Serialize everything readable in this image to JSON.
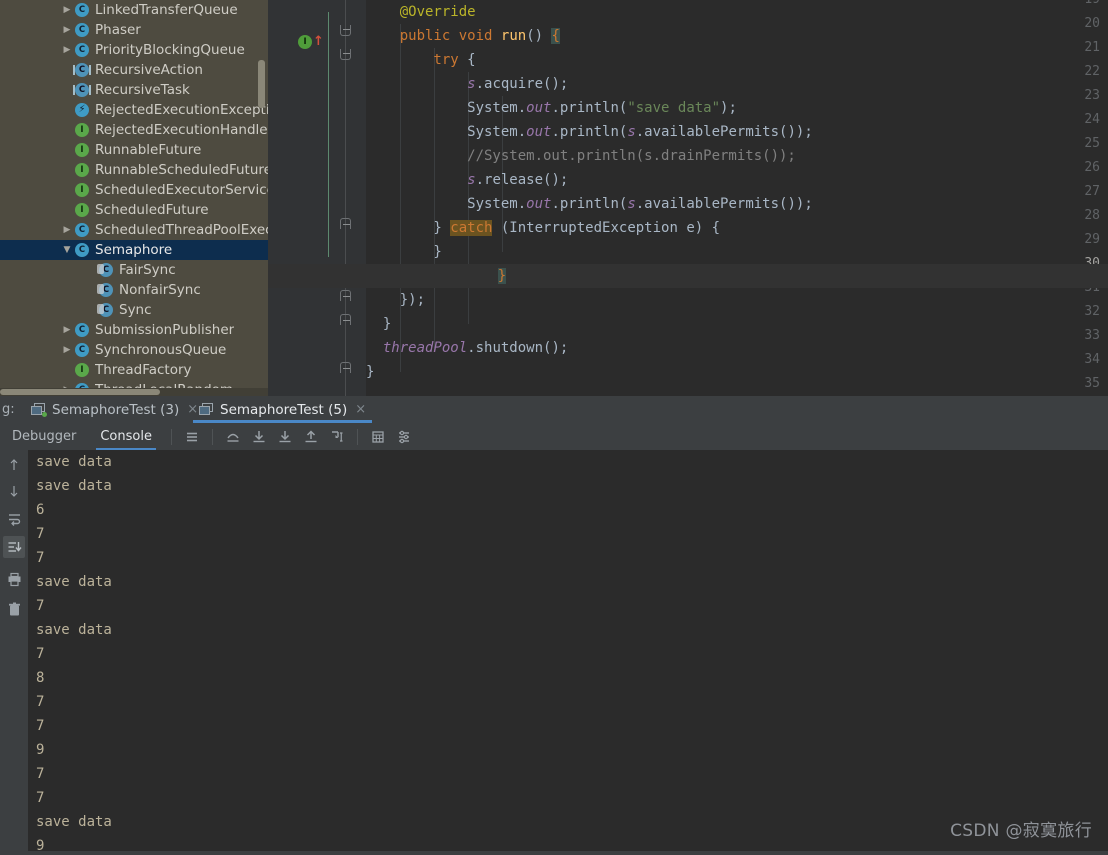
{
  "tree": {
    "name": "structure-tree",
    "items": [
      {
        "label": "LinkedTransferQueue",
        "indent": 0,
        "twisty": "collapsed",
        "icon": "class-icon",
        "glyph": "C",
        "kind": "cls",
        "selected": false
      },
      {
        "label": "Phaser",
        "indent": 0,
        "twisty": "collapsed",
        "icon": "class-icon",
        "glyph": "C",
        "kind": "cls",
        "selected": false
      },
      {
        "label": "PriorityBlockingQueue",
        "indent": 0,
        "twisty": "collapsed",
        "icon": "class-icon",
        "glyph": "C",
        "kind": "cls",
        "selected": false
      },
      {
        "label": "RecursiveAction",
        "indent": 0,
        "twisty": "none",
        "icon": "abstract-class-icon",
        "glyph": "C",
        "kind": "abs",
        "selected": false
      },
      {
        "label": "RecursiveTask",
        "indent": 0,
        "twisty": "none",
        "icon": "abstract-class-icon",
        "glyph": "C",
        "kind": "abs",
        "selected": false
      },
      {
        "label": "RejectedExecutionExceptio",
        "indent": 0,
        "twisty": "none",
        "icon": "exception-class-icon",
        "glyph": "⚡",
        "kind": "excp",
        "selected": false
      },
      {
        "label": "RejectedExecutionHandler",
        "indent": 0,
        "twisty": "none",
        "icon": "interface-icon",
        "glyph": "I",
        "kind": "iface",
        "selected": false
      },
      {
        "label": "RunnableFuture",
        "indent": 0,
        "twisty": "none",
        "icon": "interface-icon",
        "glyph": "I",
        "kind": "iface",
        "selected": false
      },
      {
        "label": "RunnableScheduledFuture",
        "indent": 0,
        "twisty": "none",
        "icon": "interface-icon",
        "glyph": "I",
        "kind": "iface",
        "selected": false
      },
      {
        "label": "ScheduledExecutorService",
        "indent": 0,
        "twisty": "none",
        "icon": "interface-icon",
        "glyph": "I",
        "kind": "iface",
        "selected": false
      },
      {
        "label": "ScheduledFuture",
        "indent": 0,
        "twisty": "none",
        "icon": "interface-icon",
        "glyph": "I",
        "kind": "iface",
        "selected": false
      },
      {
        "label": "ScheduledThreadPoolExecu",
        "indent": 0,
        "twisty": "collapsed",
        "icon": "class-icon",
        "glyph": "C",
        "kind": "cls",
        "selected": false
      },
      {
        "label": "Semaphore",
        "indent": 0,
        "twisty": "expanded",
        "icon": "class-icon",
        "glyph": "C",
        "kind": "cls",
        "selected": true
      },
      {
        "label": "FairSync",
        "indent": 1,
        "twisty": "none",
        "icon": "inner-class-icon",
        "glyph": "C",
        "kind": "inner",
        "selected": false
      },
      {
        "label": "NonfairSync",
        "indent": 1,
        "twisty": "none",
        "icon": "inner-class-icon",
        "glyph": "C",
        "kind": "inner",
        "selected": false
      },
      {
        "label": "Sync",
        "indent": 1,
        "twisty": "none",
        "icon": "inner-class-icon",
        "glyph": "C",
        "kind": "inner",
        "selected": false
      },
      {
        "label": "SubmissionPublisher",
        "indent": 0,
        "twisty": "collapsed",
        "icon": "class-icon",
        "glyph": "C",
        "kind": "cls",
        "selected": false
      },
      {
        "label": "SynchronousQueue",
        "indent": 0,
        "twisty": "collapsed",
        "icon": "class-icon",
        "glyph": "C",
        "kind": "cls",
        "selected": false
      },
      {
        "label": "ThreadFactory",
        "indent": 0,
        "twisty": "none",
        "icon": "interface-icon",
        "glyph": "I",
        "kind": "iface",
        "selected": false
      },
      {
        "label": "ThreadLocalRandom",
        "indent": 0,
        "twisty": "collapsed",
        "icon": "class-icon",
        "glyph": "C",
        "kind": "cls",
        "selected": false
      }
    ]
  },
  "editor": {
    "name": "code-editor",
    "current_line": 30,
    "run_marker_line": 20,
    "line_numbers": [
      19,
      20,
      21,
      22,
      23,
      24,
      25,
      26,
      27,
      28,
      29,
      30,
      31,
      32,
      33,
      34,
      35
    ],
    "lines": [
      {
        "num": 19,
        "text": "@Override"
      },
      {
        "num": 20,
        "text": "public void run() {"
      },
      {
        "num": 21,
        "text": "try {"
      },
      {
        "num": 22,
        "text": "s.acquire();"
      },
      {
        "num": 23,
        "text": "System.out.println(\"save data\");"
      },
      {
        "num": 24,
        "text": "System.out.println(s.availablePermits());"
      },
      {
        "num": 25,
        "text": "//System.out.println(s.drainPermits());"
      },
      {
        "num": 26,
        "text": "s.release();"
      },
      {
        "num": 27,
        "text": "System.out.println(s.availablePermits());"
      },
      {
        "num": 28,
        "text": "} catch (InterruptedException e) {"
      },
      {
        "num": 29,
        "text": "}"
      },
      {
        "num": 30,
        "text": "}"
      },
      {
        "num": 31,
        "text": "});"
      },
      {
        "num": 32,
        "text": "}"
      },
      {
        "num": 33,
        "text": "threadPool.shutdown();"
      },
      {
        "num": 34,
        "text": "}"
      },
      {
        "num": 35,
        "text": ""
      }
    ]
  },
  "toolwindow": {
    "label": "g:",
    "tabs": [
      {
        "label": "SemaphoreTest (3)",
        "active": false,
        "close": "×",
        "running": true
      },
      {
        "label": "SemaphoreTest (5)",
        "active": true,
        "close": "×",
        "running": false
      }
    ],
    "panes": [
      {
        "label": "Debugger",
        "active": false
      },
      {
        "label": "Console",
        "active": true
      }
    ],
    "toolbar_buttons": [
      {
        "name": "frames-menu-icon"
      },
      {
        "name": "step-over-icon"
      },
      {
        "name": "step-into-icon"
      },
      {
        "name": "force-step-into-icon"
      },
      {
        "name": "step-out-icon"
      },
      {
        "name": "run-to-cursor-icon"
      },
      {
        "name": "evaluate-expression-icon"
      },
      {
        "name": "settings-icon"
      }
    ],
    "side_buttons": [
      {
        "name": "scroll-up-icon",
        "active": false
      },
      {
        "name": "scroll-down-icon",
        "active": false
      },
      {
        "name": "soft-wrap-icon",
        "active": false
      },
      {
        "name": "scroll-to-end-icon",
        "active": true
      },
      {
        "name": "print-icon",
        "active": false
      },
      {
        "name": "clear-all-icon",
        "active": false
      }
    ]
  },
  "console": {
    "name": "console-output",
    "lines": [
      "save data",
      "save data",
      "6",
      "7",
      "7",
      "save data",
      "7",
      "save data",
      "7",
      "8",
      "7",
      "7",
      "9",
      "7",
      "7",
      "save data",
      "9"
    ]
  },
  "watermark": {
    "text": "CSDN @寂寞旅行"
  },
  "colors": {
    "tree_bg": "#4e4b40",
    "tree_selected": "#0d2d4e",
    "editor_bg": "#2b2b2b",
    "gutter_bg": "#313335",
    "toolwindow_bg": "#3c3f41",
    "accent_blue": "#4a88c7",
    "keyword": "#cc7832",
    "string": "#6a8759",
    "comment": "#808080",
    "field": "#9876aa",
    "annotation": "#bbb529",
    "plain": "#a9b7c6",
    "console_text": "#bbb29a"
  }
}
